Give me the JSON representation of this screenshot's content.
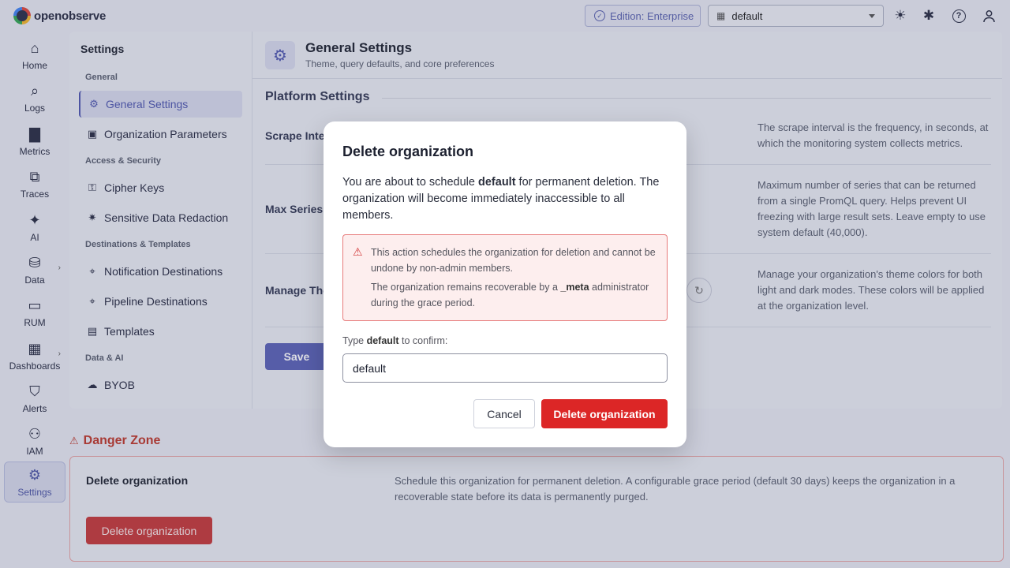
{
  "app": {
    "logo_text": "openobserve",
    "edition_label": "Edition: Enterprise",
    "org_selected": "default"
  },
  "nav": {
    "items": [
      {
        "label": "Home",
        "icon": "home-icon"
      },
      {
        "label": "Logs",
        "icon": "search-icon"
      },
      {
        "label": "Metrics",
        "icon": "bar-chart-icon"
      },
      {
        "label": "Traces",
        "icon": "traces-icon"
      },
      {
        "label": "AI",
        "icon": "sparkle-icon"
      },
      {
        "label": "Data",
        "icon": "database-icon"
      },
      {
        "label": "RUM",
        "icon": "devices-icon"
      },
      {
        "label": "Dashboards",
        "icon": "grid-icon"
      },
      {
        "label": "Alerts",
        "icon": "shield-icon"
      },
      {
        "label": "IAM",
        "icon": "user-gear-icon"
      },
      {
        "label": "Settings",
        "icon": "gear-icon"
      }
    ]
  },
  "settings_sidebar": {
    "title": "Settings",
    "groups": {
      "general": "General",
      "access": "Access & Security",
      "destinations": "Destinations & Templates",
      "data_ai": "Data & AI"
    },
    "items": {
      "general_settings": "General Settings",
      "org_params": "Organization Parameters",
      "cipher_keys": "Cipher Keys",
      "sensitive_redaction": "Sensitive Data Redaction",
      "notification_destinations": "Notification Destinations",
      "pipeline_destinations": "Pipeline Destinations",
      "templates": "Templates",
      "byob": "BYOB"
    }
  },
  "main": {
    "title": "General Settings",
    "subtitle": "Theme, query defaults, and core preferences",
    "section_title": "Platform Settings",
    "rows": {
      "scrape_label": "Scrape Inte",
      "scrape_desc": "The scrape interval is the frequency, in seconds, at which the monitoring system collects metrics.",
      "max_series_label": "Max Series",
      "max_series_desc": "Maximum number of series that can be returned from a single PromQL query. Helps prevent UI freezing with large result sets. Leave empty to use system default (40,000).",
      "theme_label": "Manage The",
      "theme_desc": "Manage your organization's theme colors for both light and dark modes. These colors will be applied at the organization level."
    },
    "save_label": "Save"
  },
  "danger_zone": {
    "title": "Danger Zone",
    "label": "Delete organization",
    "description": "Schedule this organization for permanent deletion. A configurable grace period (default 30 days) keeps the organization in a recoverable state before its data is permanently purged.",
    "button_label": "Delete organization"
  },
  "modal": {
    "title": "Delete organization",
    "body_prefix": "You are about to schedule ",
    "body_org": "default",
    "body_suffix": " for permanent deletion. The organization will become immediately inaccessible to all members.",
    "warning_line1": "This action schedules the organization for deletion and cannot be undone by non-admin members.",
    "warning_line2_prefix": "The organization remains recoverable by a ",
    "warning_line2_bold": "_meta",
    "warning_line2_suffix": " administrator during the grace period.",
    "confirm_prefix": "Type ",
    "confirm_bold": "default",
    "confirm_suffix": " to confirm:",
    "input_value": "default",
    "cancel_label": "Cancel",
    "delete_label": "Delete organization"
  }
}
